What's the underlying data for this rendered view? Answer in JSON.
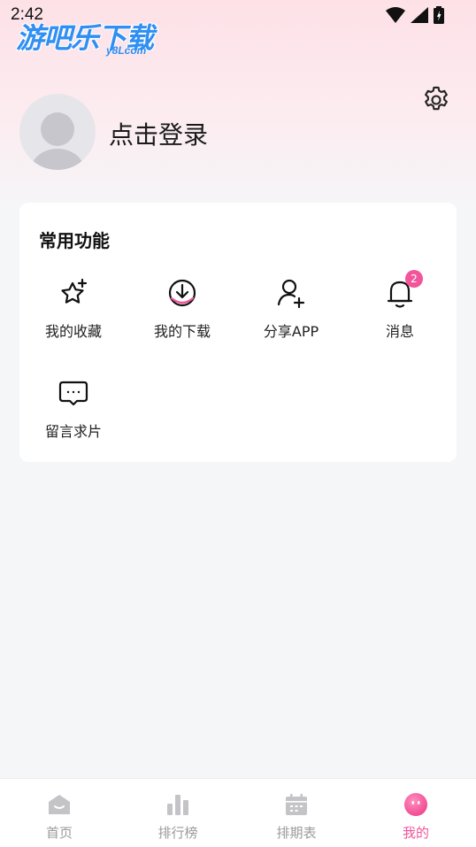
{
  "status_bar": {
    "time": "2:42"
  },
  "watermark": {
    "title": "游吧乐下载",
    "sub": "y8Lcom"
  },
  "profile": {
    "login_text": "点击登录"
  },
  "common_functions": {
    "title": "常用功能",
    "items": [
      {
        "label": "我的收藏",
        "icon": "star-plus-icon"
      },
      {
        "label": "我的下载",
        "icon": "download-icon"
      },
      {
        "label": "分享APP",
        "icon": "user-add-icon"
      },
      {
        "label": "消息",
        "icon": "bell-icon",
        "badge": "2"
      },
      {
        "label": "留言求片",
        "icon": "chat-bubble-icon"
      }
    ]
  },
  "tabbar": {
    "items": [
      {
        "label": "首页",
        "icon": "home-icon"
      },
      {
        "label": "排行榜",
        "icon": "bar-chart-icon"
      },
      {
        "label": "排期表",
        "icon": "calendar-icon"
      },
      {
        "label": "我的",
        "icon": "profile-face-icon",
        "active": true
      }
    ]
  },
  "colors": {
    "accent": "#f0559a",
    "badge": "#f2569a",
    "card": "#ffffff",
    "background": "#f5f6f8"
  }
}
